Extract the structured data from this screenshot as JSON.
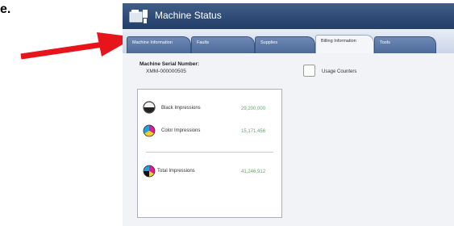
{
  "fragment_text": "e.",
  "window": {
    "title": "Machine Status",
    "tabs": [
      {
        "label": "Machine Information"
      },
      {
        "label": "Faults"
      },
      {
        "label": "Supplies"
      },
      {
        "label": "Billing Information"
      },
      {
        "label": "Tools"
      }
    ],
    "active_tab": "Billing Information"
  },
  "billing": {
    "serial_label": "Machine Serial Number:",
    "serial_value": "XMM-000000505",
    "usage_counters_label": "Usage Counters",
    "counters": [
      {
        "label": "Black Impressions",
        "value": "29,200,000"
      },
      {
        "label": "Color Impressions",
        "value": "15,171,456"
      },
      {
        "label": "Total Impressions",
        "value": "41,246,912"
      }
    ]
  },
  "colors": {
    "arrow": "#e8141b",
    "titlebar": "#2f4c78",
    "tab": "#5a76a6",
    "counter_value": "#6aa56a"
  },
  "icons": [
    "machine-icon",
    "black-toner-icon",
    "color-toner-icon",
    "total-impressions-icon"
  ]
}
